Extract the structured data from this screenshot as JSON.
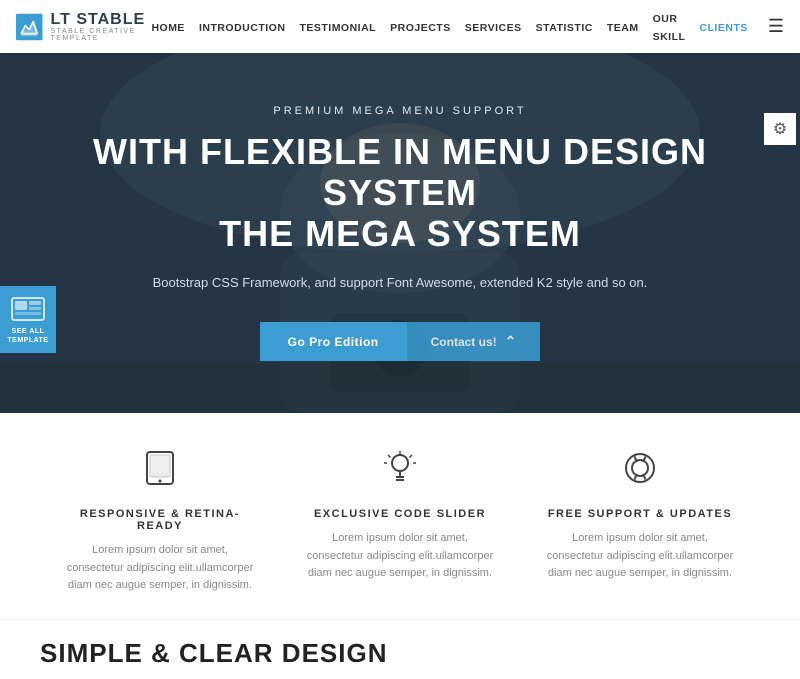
{
  "brand": {
    "name": "LT STABLE",
    "tagline": "STABLE CREATIVE TEMPLATE"
  },
  "nav": {
    "items": [
      {
        "label": "HOME",
        "active": false
      },
      {
        "label": "INTRODUCTION",
        "active": false
      },
      {
        "label": "TESTIMONIAL",
        "active": false
      },
      {
        "label": "PROJECTS",
        "active": false
      },
      {
        "label": "SERVICES",
        "active": false
      },
      {
        "label": "STATISTIC",
        "active": false
      },
      {
        "label": "TEAM",
        "active": false
      },
      {
        "label": "OUR SKILL",
        "active": false
      },
      {
        "label": "CLIENTS",
        "active": true
      }
    ]
  },
  "hero": {
    "subtitle": "PREMIUM MEGA MENU SUPPORT",
    "title_line1": "WITH FLEXIBLE IN MENU DESIGN SYSTEM",
    "title_line2": "THE MEGA SYSTEM",
    "description": "Bootstrap CSS Framework, and support Font Awesome, extended K2 style and so on.",
    "btn_pro": "Go Pro Edition",
    "btn_contact": "Contact us!"
  },
  "badge": {
    "text": "SEE ALL TEMPLATE"
  },
  "features": [
    {
      "icon": "tablet",
      "title": "RESPONSIVE & RETINA-READY",
      "text": "Lorem ipsum dolor sit amet, consectetur adipiscing elit.ullamcorper diam nec augue semper, in dignissim."
    },
    {
      "icon": "bulb",
      "title": "EXCLUSIVE CODE SLIDER",
      "text": "Lorem ipsum dolor sit amet, consectetur adipiscing elit.ullamcorper diam nec augue semper, in dignissim."
    },
    {
      "icon": "lifebuoy",
      "title": "FREE SUPPORT & UPDATES",
      "text": "Lorem ipsum dolor sit amet, consectetur adipiscing elit.ullamcorper diam nec augue semper, in dignissim."
    }
  ],
  "bottom": {
    "title": "SIMPLE & CLEAR DESIGN"
  }
}
